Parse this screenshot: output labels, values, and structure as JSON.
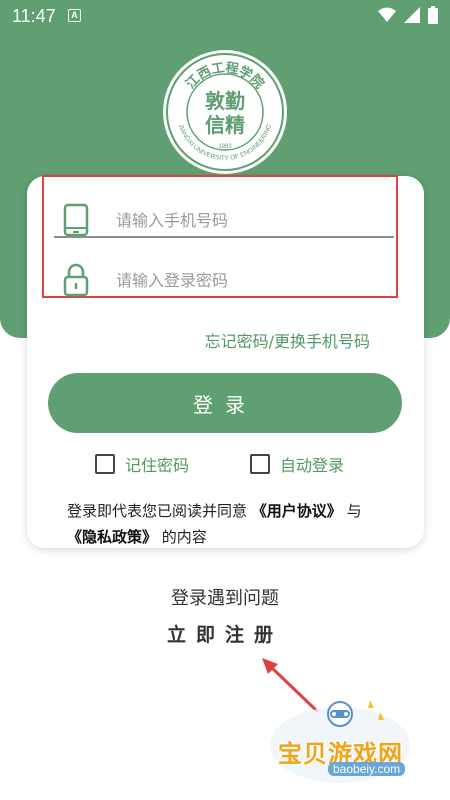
{
  "status_bar": {
    "time": "11:47",
    "notification_icon": "A"
  },
  "emblem": {
    "arc_text": "江西工程学院",
    "english_text": "JIANGXI UNIVERSITY OF ENGINEERING",
    "year": "1983",
    "center_chars": [
      "敦勤",
      "信精"
    ]
  },
  "login_form": {
    "phone_placeholder": "请输入手机号码",
    "password_placeholder": "请输入登录密码",
    "forgot_link": "忘记密码/更换手机号码",
    "login_button": "登录",
    "remember_password": "记住密码",
    "auto_login": "自动登录",
    "agreement_prefix": "登录即代表您已阅读并同意",
    "user_agreement": "《用户协议》",
    "agreement_and": "与",
    "privacy_policy": "《隐私政策》",
    "agreement_suffix": "的内容"
  },
  "footer": {
    "problem_link": "登录遇到问题",
    "register_link": "立即注册"
  },
  "watermark": {
    "name": "宝贝游戏网",
    "url": "baobeiy.com"
  },
  "colors": {
    "primary_green": "#5f9f72",
    "link_green": "#4f9a63",
    "highlight_red": "#e0403f"
  }
}
